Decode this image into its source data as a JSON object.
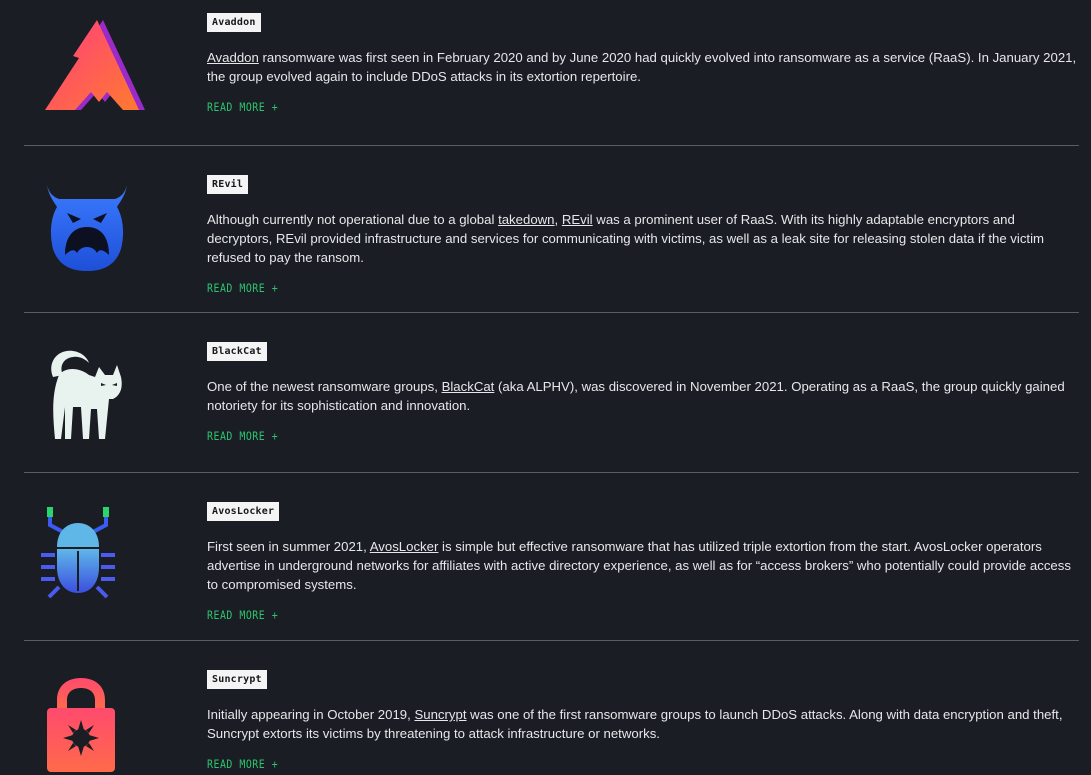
{
  "entries": [
    {
      "tag": "Avaddon",
      "pre": "",
      "link1": "Avaddon",
      "mid": "",
      "link2": "",
      "post": " ransomware was first seen in February 2020 and by June 2020 had quickly evolved into ransomware as a service (RaaS). In January 2021, the group evolved again to include DDoS attacks in its extortion repertoire.",
      "read_more": "READ MORE +",
      "icon": "avaddon-logo-icon"
    },
    {
      "tag": "REvil",
      "pre": "Although currently not operational due to a global ",
      "link1": "takedown",
      "mid": ", ",
      "link2": "REvil",
      "post": " was a prominent user of RaaS. With its highly adaptable encryptors and decryptors, REvil provided infrastructure and services for communicating with victims, as well as a leak site for releasing stolen data if the victim refused to pay the ransom.",
      "read_more": "READ MORE +",
      "icon": "revil-demon-icon"
    },
    {
      "tag": "BlackCat",
      "pre": "One of the newest ransomware groups, ",
      "link1": "BlackCat",
      "mid": "",
      "link2": "",
      "post": " (aka ALPHV), was discovered in November 2021. Operating as a RaaS, the group quickly gained notoriety for its sophistication and innovation.",
      "read_more": "READ MORE +",
      "icon": "blackcat-cat-icon"
    },
    {
      "tag": "AvosLocker",
      "pre": "First seen in summer 2021, ",
      "link1": "AvosLocker",
      "mid": "",
      "link2": "",
      "post": " is simple but effective ransomware that has utilized triple extortion from the start. AvosLocker operators advertise in underground networks for affiliates with active directory experience, as well as for “access brokers” who potentially could provide access to compromised systems.",
      "read_more": "READ MORE +",
      "icon": "avoslocker-bug-icon"
    },
    {
      "tag": "Suncrypt",
      "pre": "Initially appearing in October 2019, ",
      "link1": "Suncrypt",
      "mid": "",
      "link2": "",
      "post": " was one of the first ransomware groups to launch DDoS attacks. Along with data encryption and theft, Suncrypt extorts its victims by threatening to attack infrastructure or networks.",
      "read_more": "READ MORE +",
      "icon": "suncrypt-lock-icon"
    }
  ],
  "colors": {
    "background": "#1b1d24",
    "accent_green": "#2bc46e",
    "tag_bg": "#f4f4f4"
  }
}
